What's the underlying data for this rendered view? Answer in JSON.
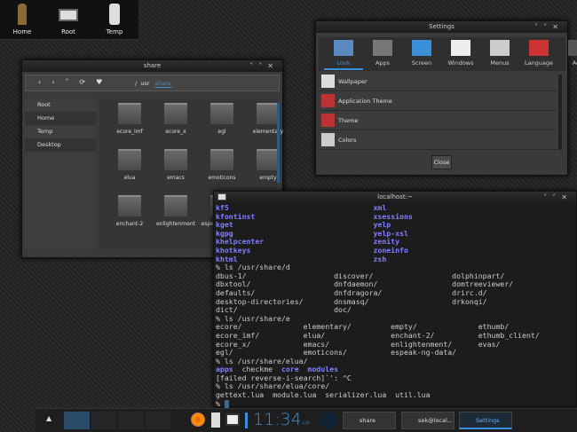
{
  "desktop": {
    "icons": [
      {
        "label": "Home"
      },
      {
        "label": "Root"
      },
      {
        "label": "Temp"
      }
    ]
  },
  "file_manager": {
    "title": "share",
    "path": [
      "/",
      "usr",
      "share"
    ],
    "sidebar": [
      {
        "label": "Root"
      },
      {
        "label": "Home"
      },
      {
        "label": "Temp"
      },
      {
        "label": "Desktop"
      }
    ],
    "folders": [
      "ecore_imf",
      "ecore_x",
      "egl",
      "elementary",
      "elua",
      "emacs",
      "emoticons",
      "empty",
      "enchant-2",
      "enlightenment",
      "espeak-ng-data"
    ]
  },
  "settings": {
    "title": "Settings",
    "tabs": [
      {
        "label": "Look"
      },
      {
        "label": "Apps"
      },
      {
        "label": "Screen"
      },
      {
        "label": "Windows"
      },
      {
        "label": "Menus"
      },
      {
        "label": "Language"
      },
      {
        "label": "Adv"
      }
    ],
    "items": [
      {
        "label": "Wallpaper"
      },
      {
        "label": "Application Theme"
      },
      {
        "label": "Theme"
      },
      {
        "label": "Colors"
      }
    ],
    "close_label": "Close"
  },
  "terminal": {
    "title": "localhost:~",
    "lines": [
      [
        [
          "kf5",
          "b"
        ],
        [
          "                                 ",
          ""
        ],
        [
          "xml",
          "b"
        ]
      ],
      [
        [
          "kfontinst",
          "b"
        ],
        [
          "                           ",
          ""
        ],
        [
          "xsessions",
          "b"
        ]
      ],
      [
        [
          "kget",
          "b"
        ],
        [
          "                                ",
          ""
        ],
        [
          "yelp",
          "b"
        ]
      ],
      [
        [
          "kgpg",
          "b"
        ],
        [
          "                                ",
          ""
        ],
        [
          "yelp-xsl",
          "b"
        ]
      ],
      [
        [
          "khelpcenter",
          "b"
        ],
        [
          "                         ",
          ""
        ],
        [
          "zenity",
          "b"
        ]
      ],
      [
        [
          "khotkeys",
          "b"
        ],
        [
          "                            ",
          ""
        ],
        [
          "zoneinfo",
          "b"
        ]
      ],
      [
        [
          "khtml",
          "b"
        ],
        [
          "                               ",
          ""
        ],
        [
          "zsh",
          "b"
        ]
      ],
      [
        [
          "% ls /usr/share/d",
          ""
        ]
      ],
      [
        [
          "dbus-1/                    discover/                  dolphinpart/",
          ""
        ]
      ],
      [
        [
          "dbxtool/                   dnfdaemon/                 domtreeviewer/",
          ""
        ]
      ],
      [
        [
          "defaults/                  dnfdragora/                drirc.d/",
          ""
        ]
      ],
      [
        [
          "desktop-directories/       dnsmasq/                   drkonqi/",
          ""
        ]
      ],
      [
        [
          "dict/                      doc/",
          ""
        ]
      ],
      [
        [
          "% ls /usr/share/e",
          ""
        ]
      ],
      [
        [
          "ecore/              elementary/         empty/              ethumb/",
          ""
        ]
      ],
      [
        [
          "ecore_imf/          elua/               enchant-2/          ethumb_client/",
          ""
        ]
      ],
      [
        [
          "ecore_x/            emacs/              enlightenment/      evas/",
          ""
        ]
      ],
      [
        [
          "egl/                emoticons/          espeak-ng-data/",
          ""
        ]
      ],
      [
        [
          "% ls /usr/share/elua/",
          ""
        ]
      ],
      [
        [
          "apps",
          "b"
        ],
        [
          "  checkme  ",
          ""
        ],
        [
          "core",
          "b"
        ],
        [
          "  ",
          ""
        ],
        [
          "modules",
          "b"
        ]
      ],
      [
        [
          "[failed reverse-i-search]`': ^C",
          ""
        ]
      ],
      [
        [
          "% ls /usr/share/elua/core/",
          ""
        ]
      ],
      [
        [
          "gettext.lua  module.lua  serializer.lua  util.lua",
          ""
        ]
      ],
      [
        [
          "% ",
          ""
        ]
      ]
    ]
  },
  "taskbar": {
    "clock": "11:34",
    "ampm": "AM",
    "tasks": [
      {
        "label": "share"
      },
      {
        "label": "sek@local..."
      },
      {
        "label": "Settings"
      }
    ]
  },
  "colors": {
    "accent": "#3b8fd9",
    "dir": "#8080ff"
  }
}
